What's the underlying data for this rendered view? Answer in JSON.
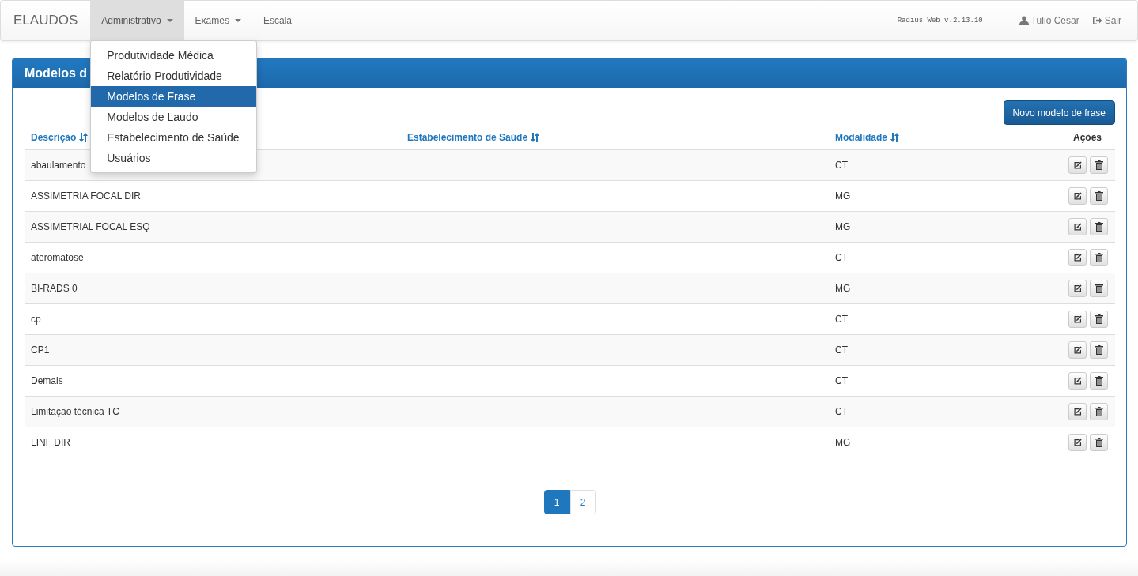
{
  "navbar": {
    "brand": "ELAUDOS",
    "menus": [
      {
        "label": "Administrativo",
        "dropdown": true,
        "expanded": true
      },
      {
        "label": "Exames",
        "dropdown": true,
        "expanded": false
      },
      {
        "label": "Escala",
        "dropdown": false,
        "expanded": false
      }
    ],
    "version": "Radius Web v.2.13.10",
    "user": "Tulio Cesar",
    "logout": "Sair"
  },
  "dropdown_menu": [
    {
      "label": "Produtividade Médica",
      "selected": false
    },
    {
      "label": "Relatório Produtividade",
      "selected": false
    },
    {
      "label": "Modelos de Frase",
      "selected": true
    },
    {
      "label": "Modelos de Laudo",
      "selected": false
    },
    {
      "label": "Estabelecimento de Saúde",
      "selected": false
    },
    {
      "label": "Usuários",
      "selected": false
    }
  ],
  "panel": {
    "title": "Modelos d",
    "new_button": "Novo modelo de frase",
    "columns": [
      {
        "label": "Descrição",
        "sortable": true
      },
      {
        "label": "Estabelecimento de Saúde",
        "sortable": true
      },
      {
        "label": "Modalidade",
        "sortable": true
      },
      {
        "label": "Ações",
        "sortable": false
      }
    ],
    "rows": [
      {
        "description": "abaulamento",
        "modality": "CT"
      },
      {
        "description": "ASSIMETRIA FOCAL DIR",
        "modality": "MG"
      },
      {
        "description": "ASSIMETRIAL FOCAL ESQ",
        "modality": "MG"
      },
      {
        "description": "ateromatose",
        "modality": "CT"
      },
      {
        "description": "BI-RADS 0",
        "modality": "MG"
      },
      {
        "description": "cp",
        "modality": "CT"
      },
      {
        "description": "CP1",
        "modality": "CT"
      },
      {
        "description": "Demais",
        "modality": "CT"
      },
      {
        "description": "Limitação técnica TC",
        "modality": "CT"
      },
      {
        "description": "LINF DIR",
        "modality": "MG"
      }
    ],
    "pagination": [
      {
        "label": "1",
        "selected": true
      },
      {
        "label": "2",
        "selected": false
      }
    ]
  }
}
